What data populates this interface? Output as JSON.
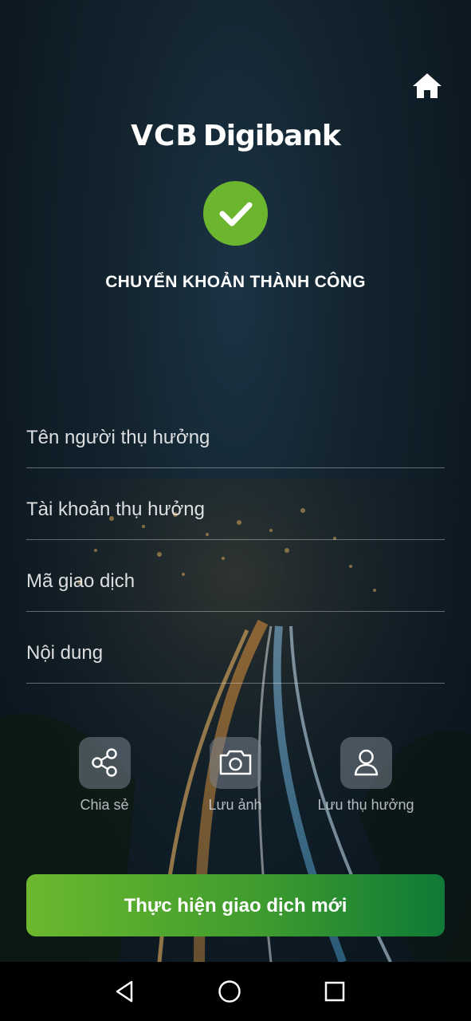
{
  "header": {
    "home_icon": "home-icon",
    "logo_vcb": "VCB",
    "logo_digibank": "Digibank"
  },
  "status": {
    "icon": "check-icon",
    "title": "CHUYỂN KHOẢN THÀNH CÔNG",
    "color": "#6cb62f"
  },
  "fields": [
    {
      "label": "Tên người thụ hưởng"
    },
    {
      "label": "Tài khoản thụ hưởng"
    },
    {
      "label": "Mã giao dịch"
    },
    {
      "label": "Nội dung"
    }
  ],
  "actions": [
    {
      "label": "Chia sẻ",
      "icon": "share-icon"
    },
    {
      "label": "Lưu ảnh",
      "icon": "camera-icon"
    },
    {
      "label": "Lưu thụ hưởng",
      "icon": "user-icon"
    }
  ],
  "primary_button": {
    "label": "Thực hiện giao dịch mới",
    "colors": [
      "#6cb82e",
      "#0f7a36"
    ]
  },
  "system_nav": {
    "back_icon": "back-triangle-icon",
    "home_icon": "home-circle-icon",
    "recents_icon": "recents-square-icon"
  }
}
